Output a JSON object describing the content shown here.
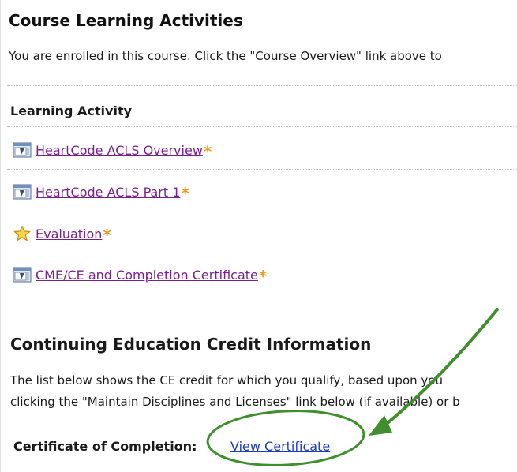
{
  "course_activities": {
    "title": "Course Learning Activities",
    "intro": "You are enrolled in this course. Click the \"Course Overview\" link above to",
    "column_header": "Learning Activity",
    "required_marker": "*",
    "items": [
      {
        "label": "HeartCode ACLS Overview",
        "icon": "module-icon"
      },
      {
        "label": "HeartCode ACLS Part 1",
        "icon": "module-icon"
      },
      {
        "label": "Evaluation",
        "icon": "star-icon"
      },
      {
        "label": "CME/CE and Completion Certificate",
        "icon": "module-icon"
      }
    ]
  },
  "ce_info": {
    "title": "Continuing Education Credit Information",
    "line1": "The list below shows the CE credit for which you qualify, based upon you",
    "line2": "clicking the \"Maintain Disciplines and Licenses\" link below (if available) or b",
    "certificate_label": "Certificate of Completion:",
    "certificate_link": "View Certificate"
  },
  "colors": {
    "link_visited": "#7a1f8f",
    "link": "#1a3bc4",
    "required_star": "#f29a1d",
    "annotation_green": "#3f8f2c"
  }
}
